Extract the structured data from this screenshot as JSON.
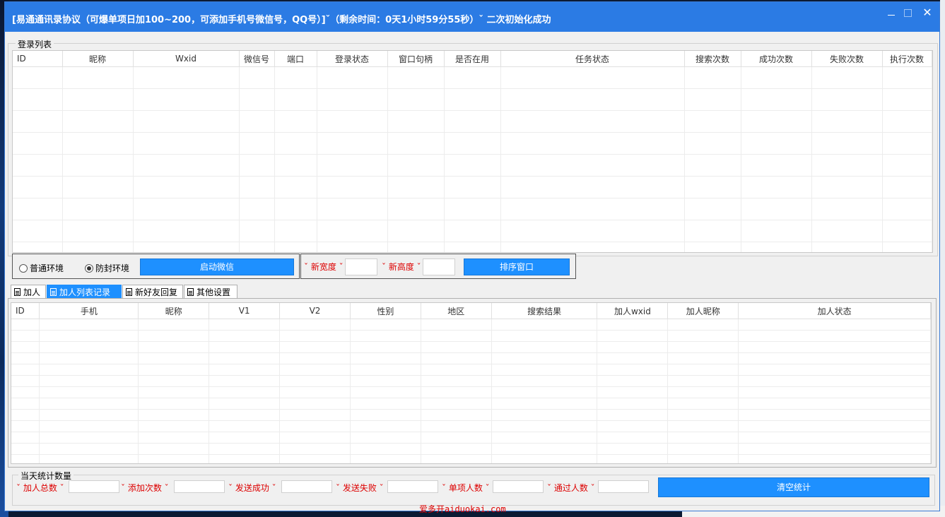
{
  "window": {
    "title": "[易通通讯录协议（可爆单项日加100~200，可添加手机号微信号，QQ号）]ˇ（剩余时间：0天1小时59分55秒）ˇ 二次初始化成功",
    "min_icon": "minimize-icon",
    "max_icon": "maximize-icon",
    "close_icon": "close-icon",
    "close_glyph": "✕"
  },
  "login_list": {
    "legend": "登录列表",
    "columns": [
      "ID",
      "昵称",
      "Wxid",
      "微信号",
      "端口",
      "登录状态",
      "窗口句柄",
      "是否在用",
      "任务状态",
      "搜索次数",
      "成功次数",
      "失败次数",
      "执行次数"
    ],
    "rows": []
  },
  "env": {
    "normal_label": "普通环境",
    "protect_label": "防封环境",
    "selected": "防封环境",
    "start_button": "启动微信"
  },
  "window_sort": {
    "width_label": "ˇ 新宽度 ˇ",
    "width_value": "",
    "height_label": "ˇ 新高度 ˇ",
    "height_value": "",
    "sort_button": "排序窗口"
  },
  "tabs": [
    {
      "label": "加人",
      "active": false
    },
    {
      "label": "加人列表记录",
      "active": true
    },
    {
      "label": "新好友回复",
      "active": false
    },
    {
      "label": "其他设置",
      "active": false
    }
  ],
  "add_list": {
    "columns": [
      "ID",
      "手机",
      "昵称",
      "V1",
      "V2",
      "性别",
      "地区",
      "搜索结果",
      "加人wxid",
      "加人昵称",
      "加人状态"
    ],
    "rows": []
  },
  "stats": {
    "legend": "当天统计数量",
    "fields": [
      {
        "label": "ˇ 加人总数 ˇ",
        "value": ""
      },
      {
        "label": "ˇ 添加次数 ˇ",
        "value": ""
      },
      {
        "label": "ˇ 发送成功 ˇ",
        "value": ""
      },
      {
        "label": "ˇ 发送失败 ˇ",
        "value": ""
      },
      {
        "label": "ˇ 单项人数 ˇ",
        "value": ""
      },
      {
        "label": "ˇ 通过人数 ˇ",
        "value": ""
      }
    ],
    "clear_button": "清空统计"
  },
  "watermark": "爱多开aiduokai.com",
  "colors": {
    "title_bar": "#2b7be4",
    "button": "#1e90ff",
    "label_red": "#dd0000"
  }
}
